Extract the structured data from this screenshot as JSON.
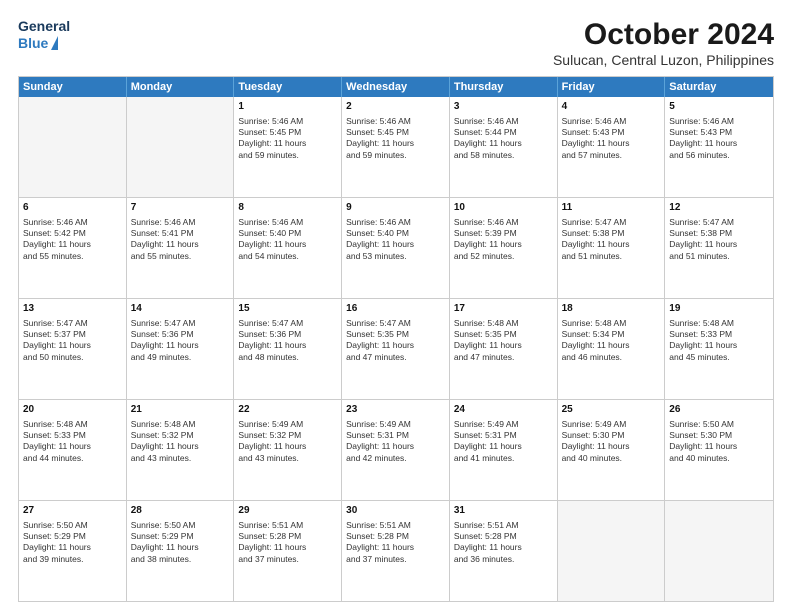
{
  "logo": {
    "line1": "General",
    "line2": "Blue"
  },
  "title": "October 2024",
  "location": "Sulucan, Central Luzon, Philippines",
  "header_days": [
    "Sunday",
    "Monday",
    "Tuesday",
    "Wednesday",
    "Thursday",
    "Friday",
    "Saturday"
  ],
  "weeks": [
    [
      {
        "day": "",
        "empty": true,
        "lines": []
      },
      {
        "day": "",
        "empty": true,
        "lines": []
      },
      {
        "day": "1",
        "empty": false,
        "lines": [
          "Sunrise: 5:46 AM",
          "Sunset: 5:45 PM",
          "Daylight: 11 hours",
          "and 59 minutes."
        ]
      },
      {
        "day": "2",
        "empty": false,
        "lines": [
          "Sunrise: 5:46 AM",
          "Sunset: 5:45 PM",
          "Daylight: 11 hours",
          "and 59 minutes."
        ]
      },
      {
        "day": "3",
        "empty": false,
        "lines": [
          "Sunrise: 5:46 AM",
          "Sunset: 5:44 PM",
          "Daylight: 11 hours",
          "and 58 minutes."
        ]
      },
      {
        "day": "4",
        "empty": false,
        "lines": [
          "Sunrise: 5:46 AM",
          "Sunset: 5:43 PM",
          "Daylight: 11 hours",
          "and 57 minutes."
        ]
      },
      {
        "day": "5",
        "empty": false,
        "lines": [
          "Sunrise: 5:46 AM",
          "Sunset: 5:43 PM",
          "Daylight: 11 hours",
          "and 56 minutes."
        ]
      }
    ],
    [
      {
        "day": "6",
        "empty": false,
        "lines": [
          "Sunrise: 5:46 AM",
          "Sunset: 5:42 PM",
          "Daylight: 11 hours",
          "and 55 minutes."
        ]
      },
      {
        "day": "7",
        "empty": false,
        "lines": [
          "Sunrise: 5:46 AM",
          "Sunset: 5:41 PM",
          "Daylight: 11 hours",
          "and 55 minutes."
        ]
      },
      {
        "day": "8",
        "empty": false,
        "lines": [
          "Sunrise: 5:46 AM",
          "Sunset: 5:40 PM",
          "Daylight: 11 hours",
          "and 54 minutes."
        ]
      },
      {
        "day": "9",
        "empty": false,
        "lines": [
          "Sunrise: 5:46 AM",
          "Sunset: 5:40 PM",
          "Daylight: 11 hours",
          "and 53 minutes."
        ]
      },
      {
        "day": "10",
        "empty": false,
        "lines": [
          "Sunrise: 5:46 AM",
          "Sunset: 5:39 PM",
          "Daylight: 11 hours",
          "and 52 minutes."
        ]
      },
      {
        "day": "11",
        "empty": false,
        "lines": [
          "Sunrise: 5:47 AM",
          "Sunset: 5:38 PM",
          "Daylight: 11 hours",
          "and 51 minutes."
        ]
      },
      {
        "day": "12",
        "empty": false,
        "lines": [
          "Sunrise: 5:47 AM",
          "Sunset: 5:38 PM",
          "Daylight: 11 hours",
          "and 51 minutes."
        ]
      }
    ],
    [
      {
        "day": "13",
        "empty": false,
        "lines": [
          "Sunrise: 5:47 AM",
          "Sunset: 5:37 PM",
          "Daylight: 11 hours",
          "and 50 minutes."
        ]
      },
      {
        "day": "14",
        "empty": false,
        "lines": [
          "Sunrise: 5:47 AM",
          "Sunset: 5:36 PM",
          "Daylight: 11 hours",
          "and 49 minutes."
        ]
      },
      {
        "day": "15",
        "empty": false,
        "lines": [
          "Sunrise: 5:47 AM",
          "Sunset: 5:36 PM",
          "Daylight: 11 hours",
          "and 48 minutes."
        ]
      },
      {
        "day": "16",
        "empty": false,
        "lines": [
          "Sunrise: 5:47 AM",
          "Sunset: 5:35 PM",
          "Daylight: 11 hours",
          "and 47 minutes."
        ]
      },
      {
        "day": "17",
        "empty": false,
        "lines": [
          "Sunrise: 5:48 AM",
          "Sunset: 5:35 PM",
          "Daylight: 11 hours",
          "and 47 minutes."
        ]
      },
      {
        "day": "18",
        "empty": false,
        "lines": [
          "Sunrise: 5:48 AM",
          "Sunset: 5:34 PM",
          "Daylight: 11 hours",
          "and 46 minutes."
        ]
      },
      {
        "day": "19",
        "empty": false,
        "lines": [
          "Sunrise: 5:48 AM",
          "Sunset: 5:33 PM",
          "Daylight: 11 hours",
          "and 45 minutes."
        ]
      }
    ],
    [
      {
        "day": "20",
        "empty": false,
        "lines": [
          "Sunrise: 5:48 AM",
          "Sunset: 5:33 PM",
          "Daylight: 11 hours",
          "and 44 minutes."
        ]
      },
      {
        "day": "21",
        "empty": false,
        "lines": [
          "Sunrise: 5:48 AM",
          "Sunset: 5:32 PM",
          "Daylight: 11 hours",
          "and 43 minutes."
        ]
      },
      {
        "day": "22",
        "empty": false,
        "lines": [
          "Sunrise: 5:49 AM",
          "Sunset: 5:32 PM",
          "Daylight: 11 hours",
          "and 43 minutes."
        ]
      },
      {
        "day": "23",
        "empty": false,
        "lines": [
          "Sunrise: 5:49 AM",
          "Sunset: 5:31 PM",
          "Daylight: 11 hours",
          "and 42 minutes."
        ]
      },
      {
        "day": "24",
        "empty": false,
        "lines": [
          "Sunrise: 5:49 AM",
          "Sunset: 5:31 PM",
          "Daylight: 11 hours",
          "and 41 minutes."
        ]
      },
      {
        "day": "25",
        "empty": false,
        "lines": [
          "Sunrise: 5:49 AM",
          "Sunset: 5:30 PM",
          "Daylight: 11 hours",
          "and 40 minutes."
        ]
      },
      {
        "day": "26",
        "empty": false,
        "lines": [
          "Sunrise: 5:50 AM",
          "Sunset: 5:30 PM",
          "Daylight: 11 hours",
          "and 40 minutes."
        ]
      }
    ],
    [
      {
        "day": "27",
        "empty": false,
        "lines": [
          "Sunrise: 5:50 AM",
          "Sunset: 5:29 PM",
          "Daylight: 11 hours",
          "and 39 minutes."
        ]
      },
      {
        "day": "28",
        "empty": false,
        "lines": [
          "Sunrise: 5:50 AM",
          "Sunset: 5:29 PM",
          "Daylight: 11 hours",
          "and 38 minutes."
        ]
      },
      {
        "day": "29",
        "empty": false,
        "lines": [
          "Sunrise: 5:51 AM",
          "Sunset: 5:28 PM",
          "Daylight: 11 hours",
          "and 37 minutes."
        ]
      },
      {
        "day": "30",
        "empty": false,
        "lines": [
          "Sunrise: 5:51 AM",
          "Sunset: 5:28 PM",
          "Daylight: 11 hours",
          "and 37 minutes."
        ]
      },
      {
        "day": "31",
        "empty": false,
        "lines": [
          "Sunrise: 5:51 AM",
          "Sunset: 5:28 PM",
          "Daylight: 11 hours",
          "and 36 minutes."
        ]
      },
      {
        "day": "",
        "empty": true,
        "lines": []
      },
      {
        "day": "",
        "empty": true,
        "lines": []
      }
    ]
  ]
}
